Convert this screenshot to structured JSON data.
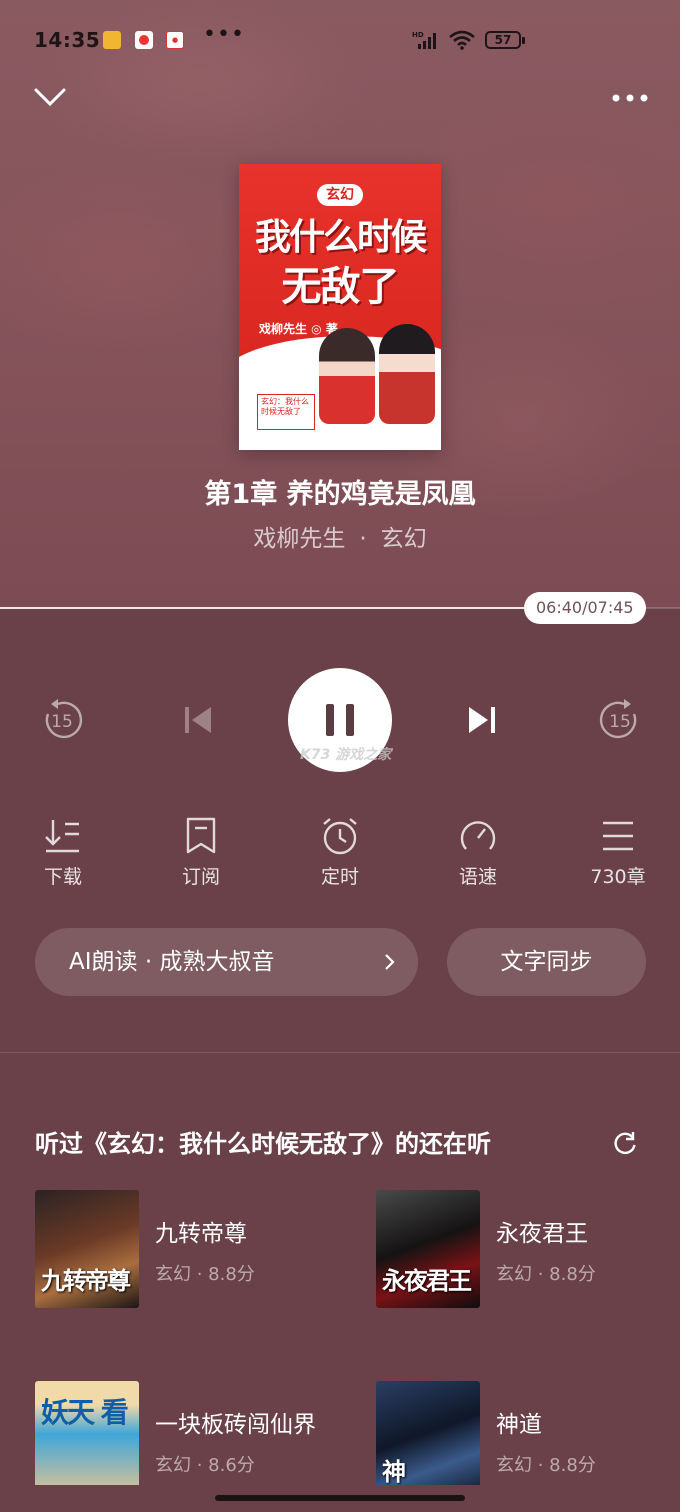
{
  "status_bar": {
    "time": "14:35",
    "battery": "57",
    "signal_label": "HD"
  },
  "book": {
    "chapter_title": "第1章 养的鸡竟是凤凰",
    "author": "戏柳先生",
    "genre": "玄幻",
    "cover": {
      "tag": "玄幻",
      "title_line1": "我什么时候",
      "title_line2": "无敌了",
      "author_text": "戏柳先生 ◎ 著",
      "note_text": "玄幻：我什么时候无敌了"
    }
  },
  "playback": {
    "position": "06:40",
    "duration": "07:45",
    "elapsed_text": "06:40/07:45",
    "progress_fraction": 0.86
  },
  "controls": {
    "rewind_seconds": "15",
    "forward_seconds": "15",
    "watermark": "K73 游戏之家"
  },
  "tools": [
    {
      "label": "下载",
      "icon": "download-icon"
    },
    {
      "label": "订阅",
      "icon": "bookmark-icon"
    },
    {
      "label": "定时",
      "icon": "alarm-clock-icon"
    },
    {
      "label": "语速",
      "icon": "speed-dial-icon"
    },
    {
      "label": "730章",
      "icon": "list-icon"
    }
  ],
  "ai_voice": {
    "label": "AI朗读 · 成熟大叔音"
  },
  "text_sync": {
    "label": "文字同步"
  },
  "recommendations": {
    "title": "听过《玄幻：我什么时候无敌了》的还在听",
    "books": [
      {
        "name": "九转帝尊",
        "info": "玄幻 · 8.8分",
        "cover_text": "九转帝尊"
      },
      {
        "name": "永夜君王",
        "info": "玄幻 · 8.8分",
        "cover_text": "永夜君王"
      },
      {
        "name": "一块板砖闯仙界",
        "info": "玄幻 · 8.6分",
        "cover_text": "妖天 看"
      },
      {
        "name": "神道",
        "info": "玄幻 · 8.8分",
        "cover_text": "神"
      }
    ]
  },
  "colors": {
    "background_top": "#8a5a61",
    "background_bottom": "#6a4049",
    "accent_red": "#d8261f"
  }
}
